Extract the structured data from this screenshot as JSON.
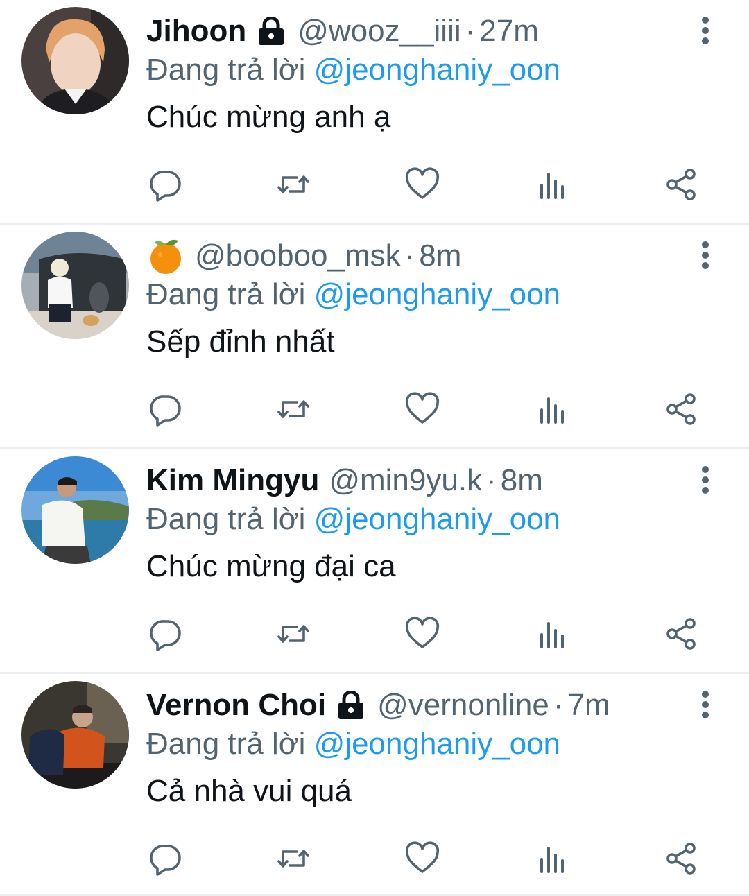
{
  "reply_prefix": "Đang trả lời",
  "replies": [
    {
      "display_name": "Jihoon",
      "locked": true,
      "handle": "@wooz__iiii",
      "separator": "·",
      "time": "27m",
      "reply_to": "@jeonghaniy_oon",
      "text": "Chúc mừng anh ạ"
    },
    {
      "display_name": "",
      "emoji": "tangerine-emoji",
      "locked": false,
      "handle": "@booboo_msk",
      "separator": "·",
      "time": "8m",
      "reply_to": "@jeonghaniy_oon",
      "text": "Sếp đỉnh nhất"
    },
    {
      "display_name": "Kim Mingyu",
      "locked": false,
      "handle": "@min9yu.k",
      "separator": "·",
      "time": "8m",
      "reply_to": "@jeonghaniy_oon",
      "text": "Chúc mừng đại ca"
    },
    {
      "display_name": "Vernon Choi",
      "locked": true,
      "handle": "@vernonline",
      "separator": "·",
      "time": "7m",
      "reply_to": "@jeonghaniy_oon",
      "text": "Cả nhà vui quá"
    }
  ],
  "icons": {
    "reply": "reply-icon",
    "retweet": "retweet-icon",
    "like": "heart-icon",
    "views": "views-icon",
    "share": "share-icon",
    "more": "more-vertical-icon",
    "lock": "lock-icon"
  },
  "colors": {
    "link": "#1d9bf0",
    "secondary_text": "#536471",
    "primary_text": "#0f1419",
    "divider": "#eceff1"
  }
}
